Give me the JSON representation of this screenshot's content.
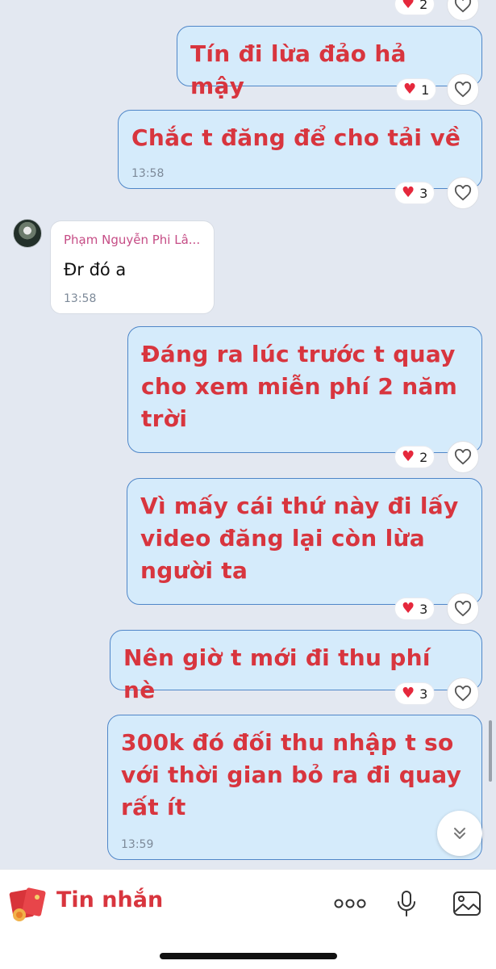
{
  "messages": [
    {
      "text": "Tín đi lừa đảo hả mậy",
      "reactions": "1"
    },
    {
      "text": "Chắc t đăng để cho tải về",
      "time": "13:58",
      "reactions": "3"
    },
    {
      "sender": "Phạm Nguyễn Phi Lâ...",
      "text": "Đr đó a",
      "time": "13:58"
    },
    {
      "text": "Đáng ra lúc trước t quay\ncho xem miễn phí 2 năm\ntrời",
      "reactions": "2"
    },
    {
      "text": "Vì mấy cái thứ này đi lấy\nvideo đăng lại còn lừa\nngười ta",
      "reactions": "3"
    },
    {
      "text": "Nên giờ t mới đi thu phí nè",
      "reactions": "3"
    },
    {
      "text": "300k đó đối thu nhập t so\nvới thời gian bỏ ra đi quay\nrất ít",
      "time": "13:59"
    }
  ],
  "top_partial": {
    "reactions": "2"
  },
  "bottom_bar": {
    "title": "Tin nhắn"
  },
  "colors": {
    "accent_red": "#d8353e",
    "bubble_bg": "#d5ebfb",
    "bubble_border": "#4f86c8",
    "heart": "#e5283c",
    "chat_bg": "#e3e8f1"
  },
  "icons": [
    "heart-icon",
    "like-outline-icon",
    "chevron-double-down-icon",
    "more-dots-icon",
    "microphone-icon",
    "image-icon",
    "sticker-icon"
  ]
}
